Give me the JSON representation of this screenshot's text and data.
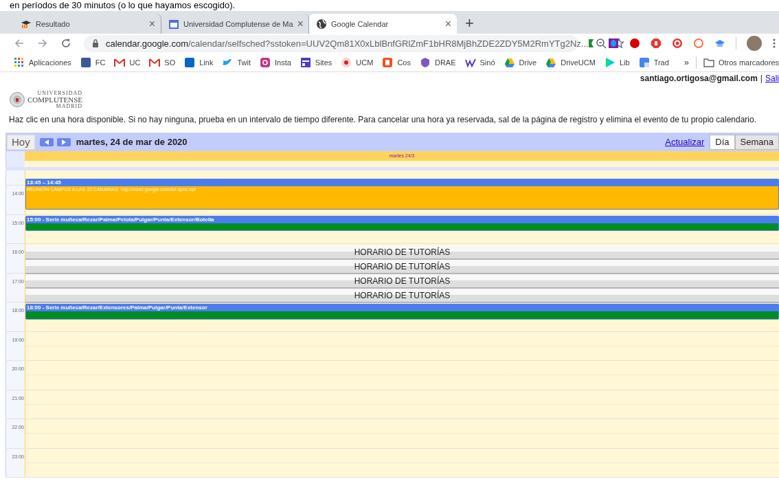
{
  "document_line": "en períodos de 30 minutos (o lo que hayamos escogido).",
  "browser": {
    "tabs": [
      {
        "title": "Resultado",
        "selected": false,
        "close": "×"
      },
      {
        "title": "Universidad Complutense de Ma",
        "selected": false,
        "close": "×"
      },
      {
        "title": "Google Calendar",
        "selected": true,
        "close": "×"
      }
    ],
    "new_tab": "+",
    "address": {
      "host": "calendar.google.com",
      "path": "/calendar/selfsched?sstoken=UUV2Qm81X0xLblBnfGRlZmF1bHR8MjBhZDE2ZDY5M2RmYTg2Nz..."
    },
    "bookmarks": [
      {
        "label": "Aplicaciones"
      },
      {
        "label": "FC"
      },
      {
        "label": "UC"
      },
      {
        "label": "SO"
      },
      {
        "label": "Link"
      },
      {
        "label": "Twit"
      },
      {
        "label": "Insta"
      },
      {
        "label": "Sites"
      },
      {
        "label": "UCM"
      },
      {
        "label": "Cos"
      },
      {
        "label": "DRAE"
      },
      {
        "label": "Sinó"
      },
      {
        "label": "Drive"
      },
      {
        "label": "DriveUCM"
      },
      {
        "label": "Lib"
      },
      {
        "label": "Trad"
      }
    ],
    "more_bookmarks": "»",
    "other_bookmarks": "Otros marcadores"
  },
  "page": {
    "account": {
      "email": "santiago.ortigosa@gmail.com",
      "separator": "|",
      "link": "Sali"
    },
    "logo": {
      "top": "UNIVERSIDAD",
      "main": "COMPLUTENSE",
      "bottom": "MADRID"
    },
    "instructions": "Haz clic en una hora disponible. Si no hay ninguna, prueba en un intervalo de tiempo diferente. Para cancelar una hora ya reservada, sal de la página de registro y elimina el evento de tu propio calendario.",
    "calendar": {
      "today": "Hoy",
      "date": "martes, 24 de mar de 2020",
      "refresh": "Actualizar",
      "views": [
        {
          "label": "Día",
          "selected": true
        },
        {
          "label": "Semana",
          "selected": false
        }
      ],
      "day_header": "martes 24/3",
      "hours": [
        "14:00",
        "15:00",
        "16:00",
        "17:00",
        "18:00",
        "19:00",
        "20:00",
        "21:00",
        "22:00",
        "23:00"
      ],
      "events": [
        {
          "kind": "booked",
          "header": "13:45 – 14:45",
          "body": "REUNIÓN CAMPUS A LAS 15 CANARIAS: http://meet.google.com/tkf-dphc-kpi",
          "color": "#ffb900"
        },
        {
          "kind": "booked",
          "header": "15:00 - Serie muñeca/Rezar/Palma/Pelota/Pulgar/Punta/Extensor/Botella",
          "color": "#008d24"
        },
        {
          "kind": "slot",
          "header": "HORARIO DE TUTORÍAS"
        },
        {
          "kind": "slot",
          "header": "HORARIO DE TUTORÍAS"
        },
        {
          "kind": "slot",
          "header": "HORARIO DE TUTORÍAS"
        },
        {
          "kind": "slot",
          "header": "HORARIO DE TUTORÍAS"
        },
        {
          "kind": "booked",
          "header": "18:00 - Serie muñeca/Rezar/Extensores/Palma/Pulgar/Punta/Extensor",
          "color": "#008d24"
        }
      ]
    }
  }
}
